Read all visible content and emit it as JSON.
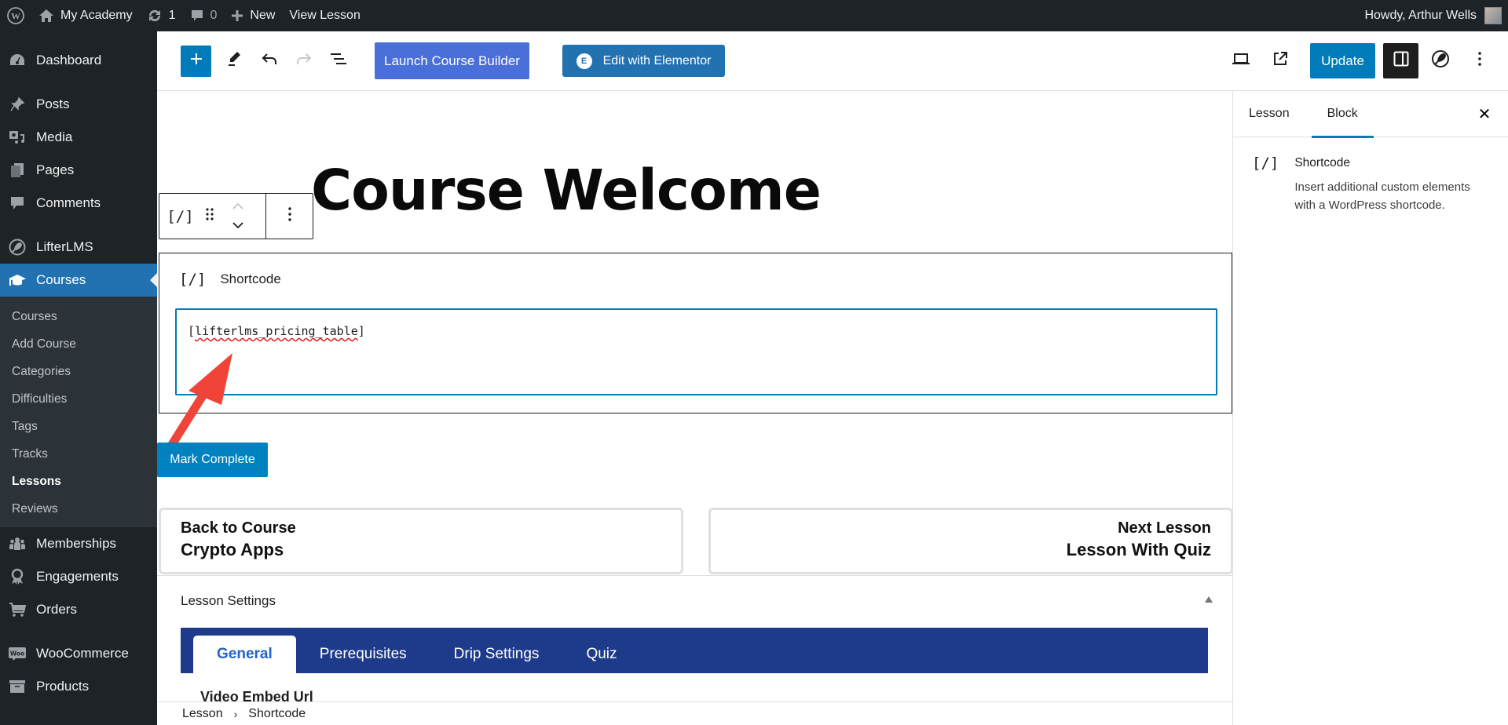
{
  "admin_bar": {
    "wp_logo_icon": "wordpress-logo-icon",
    "site_name": "My Academy",
    "updates_count": "1",
    "comments_count": "0",
    "new_label": "New",
    "view_label": "View Lesson",
    "greeting": "Howdy, Arthur Wells"
  },
  "sidebar": {
    "items": [
      {
        "label": "Dashboard",
        "icon": "dashboard-icon"
      },
      {
        "label": "Posts",
        "icon": "pin-icon"
      },
      {
        "label": "Media",
        "icon": "media-icon"
      },
      {
        "label": "Pages",
        "icon": "pages-icon"
      },
      {
        "label": "Comments",
        "icon": "comment-icon"
      },
      {
        "label": "LifterLMS",
        "icon": "rocket-icon"
      },
      {
        "label": "Courses",
        "icon": "graduation-cap-icon",
        "active": true
      },
      {
        "label": "Memberships",
        "icon": "groups-icon"
      },
      {
        "label": "Engagements",
        "icon": "award-icon"
      },
      {
        "label": "Orders",
        "icon": "cart-icon"
      },
      {
        "label": "WooCommerce",
        "icon": "woo-icon"
      },
      {
        "label": "Products",
        "icon": "archive-icon"
      }
    ],
    "submenu": [
      {
        "label": "Courses"
      },
      {
        "label": "Add Course"
      },
      {
        "label": "Categories"
      },
      {
        "label": "Difficulties"
      },
      {
        "label": "Tags"
      },
      {
        "label": "Tracks"
      },
      {
        "label": "Lessons",
        "current": true
      },
      {
        "label": "Reviews"
      }
    ]
  },
  "header": {
    "launch_builder": "Launch Course Builder",
    "edit_elementor": "Edit with Elementor",
    "elementor_glyph": "E",
    "update": "Update"
  },
  "content": {
    "title": "Course Welcome",
    "block_name": "Shortcode",
    "block_icon_glyph": "[/]",
    "shortcode_value": "[lifterlms_pricing_table]",
    "shortcode_prefix": "[",
    "shortcode_word": "lifterlms_pricing_table",
    "shortcode_suffix": "]",
    "mark_complete": "Mark Complete",
    "back_card": {
      "line1": "Back to Course",
      "line2": "Crypto Apps"
    },
    "next_card": {
      "line1": "Next Lesson",
      "line2": "Lesson With Quiz"
    }
  },
  "lesson_settings": {
    "title": "Lesson Settings",
    "tabs": [
      {
        "label": "General",
        "active": true
      },
      {
        "label": "Prerequisites"
      },
      {
        "label": "Drip Settings"
      },
      {
        "label": "Quiz"
      }
    ],
    "field_label": "Video Embed Url"
  },
  "breadcrumb": {
    "items": [
      "Lesson",
      "Shortcode"
    ],
    "separator": "›"
  },
  "right_sidebar": {
    "tabs": [
      {
        "label": "Lesson"
      },
      {
        "label": "Block",
        "active": true
      }
    ],
    "close_glyph": "✕",
    "block_name": "Shortcode",
    "block_description": "Insert additional custom elements with a WordPress shortcode."
  },
  "colors": {
    "admin_dark": "#1d2327",
    "wp_blue": "#007cba",
    "menu_active": "#2271b1",
    "launch_button": "#4a6fd8",
    "tabs_bar": "#1e3a8a",
    "annotation_arrow": "#f04438"
  }
}
